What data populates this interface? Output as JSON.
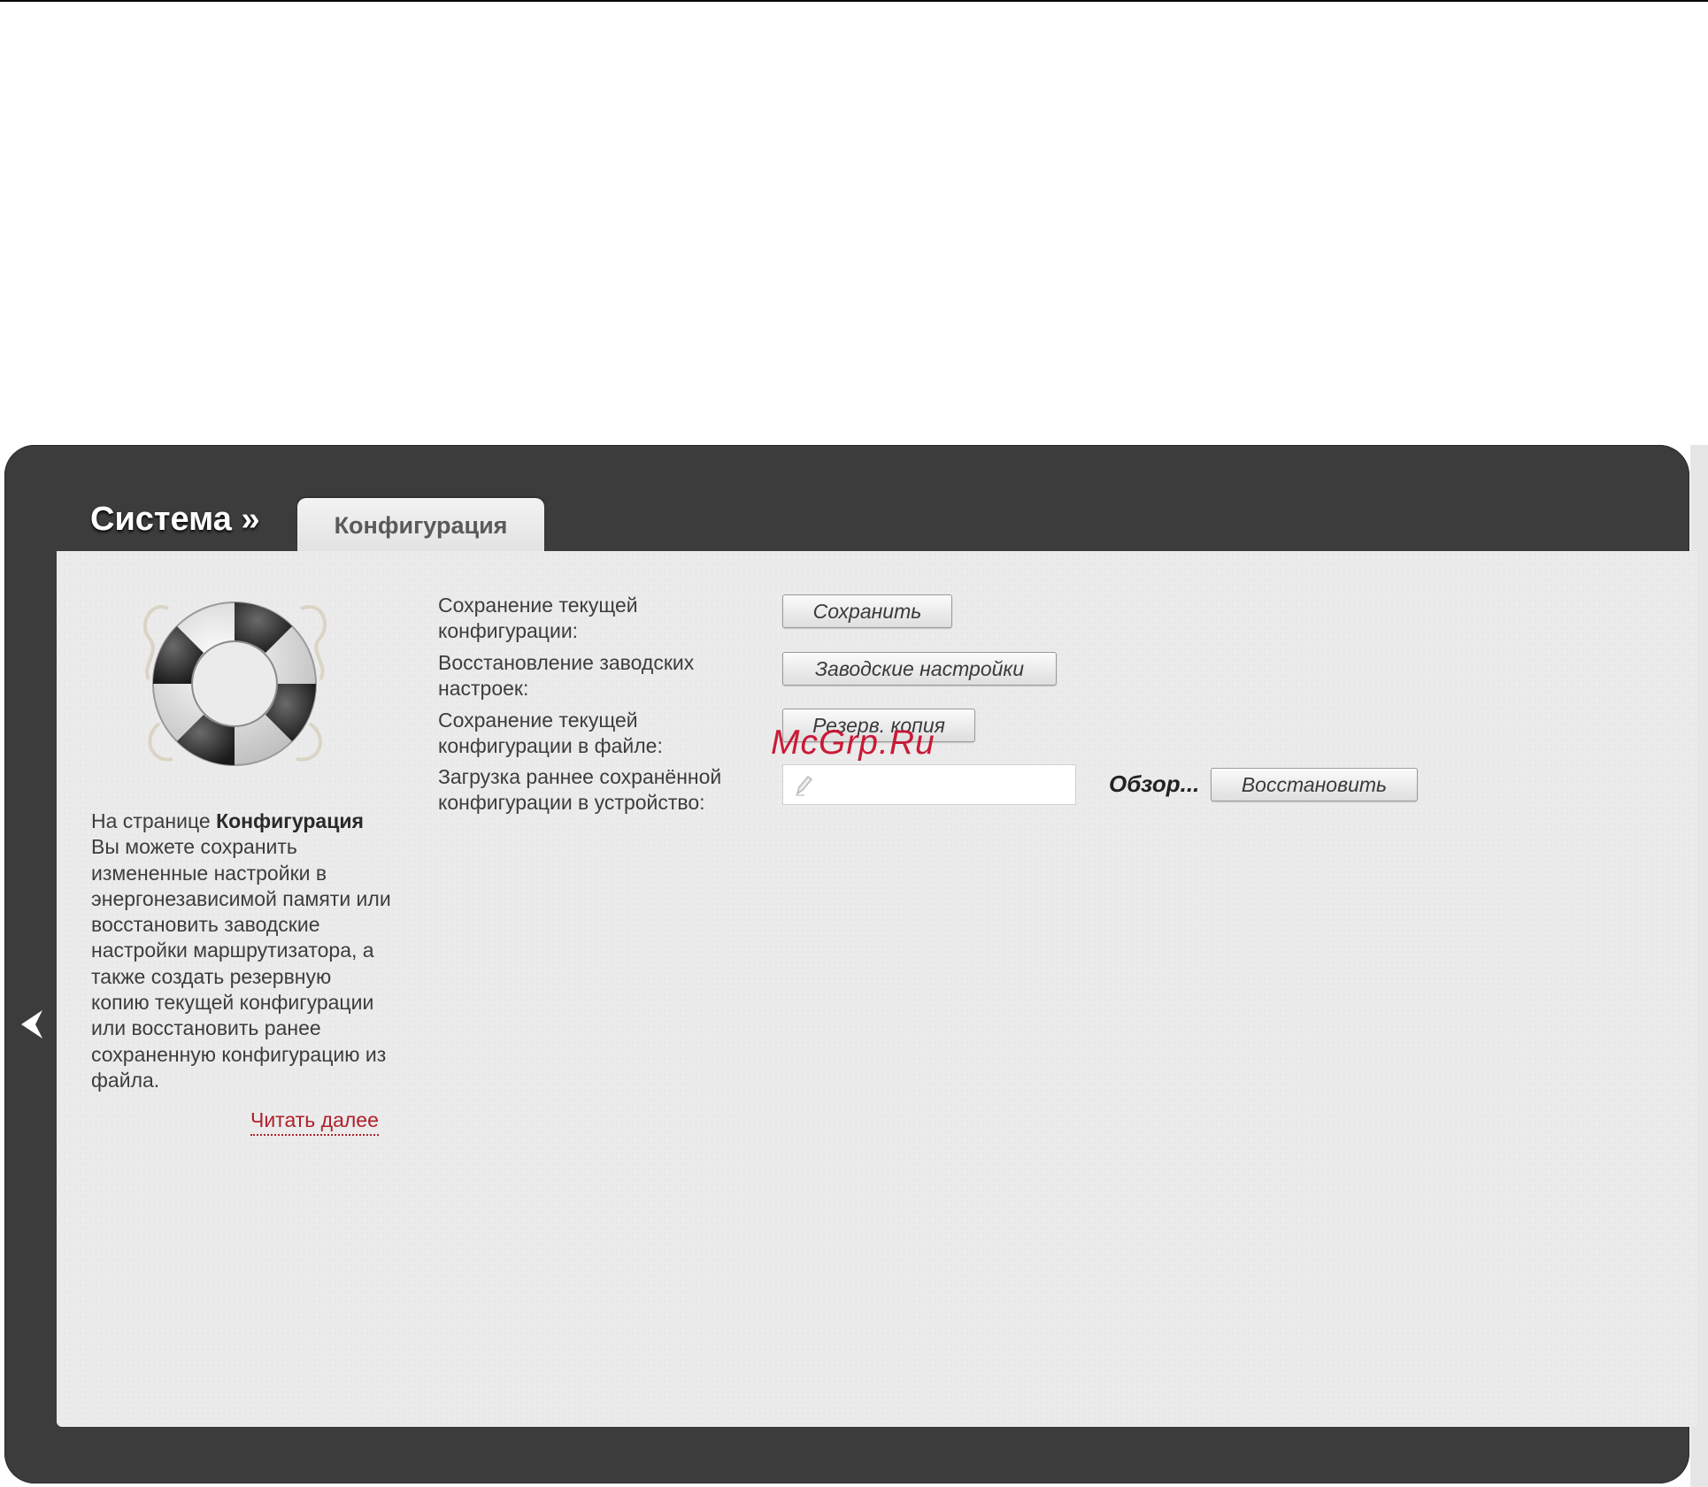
{
  "header": {
    "title": "Система »",
    "active_tab": "Конфигурация"
  },
  "sidebar": {
    "desc_prefix": "На странице ",
    "desc_bold": "Конфигурация",
    "desc_rest": " Вы можете сохранить измененные настройки в энергонезависимой памяти или восстановить заводские настройки маршрутизатора, а также создать резервную копию текущей конфигурации или восстановить ранее сохраненную конфигурацию из файла.",
    "read_more": "Читать далее"
  },
  "rows": [
    {
      "label": "Сохранение текущей конфигурации:",
      "button": "Сохранить"
    },
    {
      "label": "Восстановление заводских настроек:",
      "button": "Заводские настройки"
    },
    {
      "label": "Сохранение текущей конфигурации в файле:",
      "button": "Резерв. копия"
    },
    {
      "label": "Загрузка раннее сохранённой конфигурации в устройство:",
      "browse": "Обзор...",
      "button": "Восстановить"
    }
  ],
  "watermark": "McGrp.Ru",
  "icons": {
    "back": "chevron-left-icon",
    "illustration": "lifebuoy-icon",
    "file": "pencil-icon"
  },
  "colors": {
    "frame": "#3c3c3c",
    "panel": "#ebebeb",
    "link": "#b0202a",
    "watermark": "#c8102e"
  }
}
